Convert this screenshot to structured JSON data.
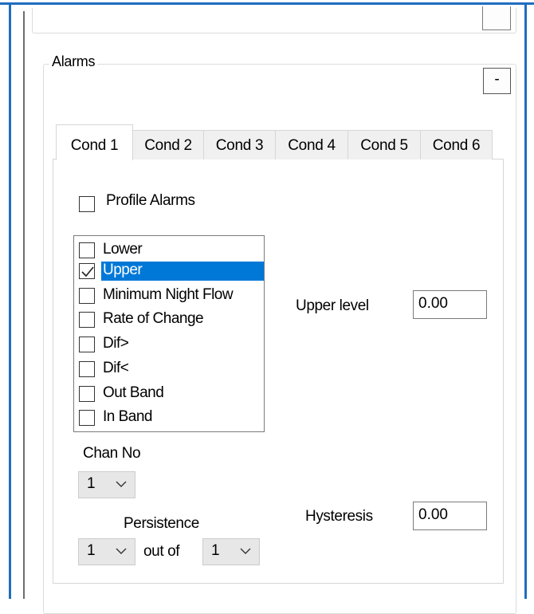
{
  "group": {
    "title": "Alarms",
    "collapse_label": "-"
  },
  "tabs": [
    {
      "label": "Cond 1",
      "active": true
    },
    {
      "label": "Cond 2",
      "active": false
    },
    {
      "label": "Cond 3",
      "active": false
    },
    {
      "label": "Cond 4",
      "active": false
    },
    {
      "label": "Cond 5",
      "active": false
    },
    {
      "label": "Cond 6",
      "active": false
    }
  ],
  "profile_alarms": {
    "label": "Profile Alarms",
    "checked": false
  },
  "alarm_types": [
    {
      "label": "Lower",
      "checked": false,
      "selected": false
    },
    {
      "label": "Upper",
      "checked": true,
      "selected": true
    },
    {
      "label": "Minimum Night Flow",
      "checked": false,
      "selected": false
    },
    {
      "label": "Rate of Change",
      "checked": false,
      "selected": false
    },
    {
      "label": "Dif>",
      "checked": false,
      "selected": false
    },
    {
      "label": "Dif<",
      "checked": false,
      "selected": false
    },
    {
      "label": "Out Band",
      "checked": false,
      "selected": false
    },
    {
      "label": "In Band",
      "checked": false,
      "selected": false
    }
  ],
  "upper_level": {
    "label": "Upper level",
    "value": "0.00"
  },
  "chan_no": {
    "label": "Chan No",
    "value": "1"
  },
  "persistence": {
    "label": "Persistence",
    "value": "1",
    "out_of_label": "out of",
    "out_of_value": "1"
  },
  "hysteresis": {
    "label": "Hysteresis",
    "value": "0.00"
  },
  "colors": {
    "selection": "#0078d7",
    "window_border": "#1f6dbf"
  }
}
